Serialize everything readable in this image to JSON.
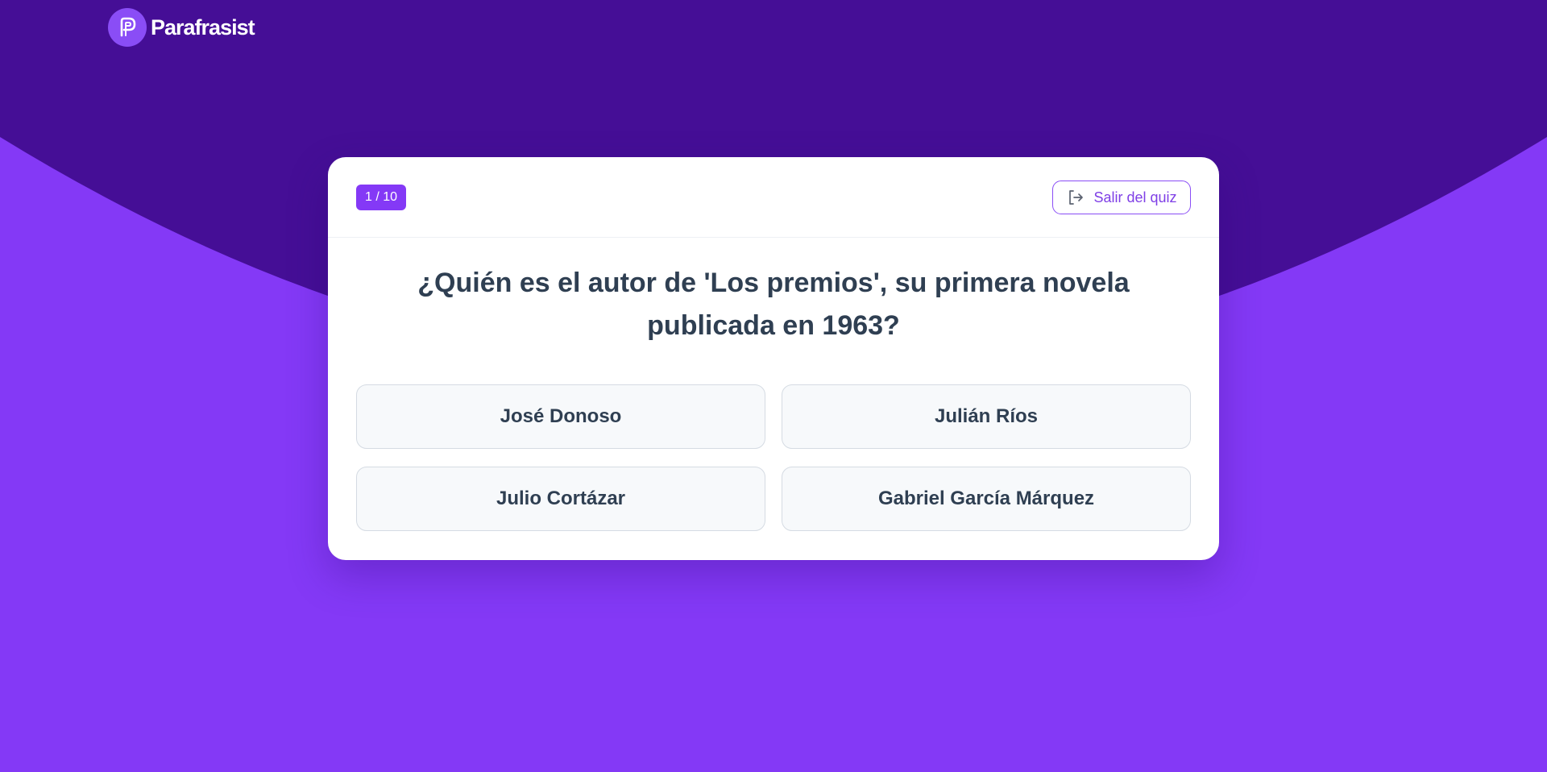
{
  "brand": {
    "name": "Parafrasist",
    "logo_icon": "parafrasist-p-logo"
  },
  "quiz": {
    "progress": "1 / 10",
    "exit_label": "Salir del quiz",
    "exit_icon": "exit-icon",
    "question": "¿Quién es el autor de 'Los premios', su primera novela publicada en 1963?",
    "answers": [
      "José Donoso",
      "Julián Ríos",
      "Julio Cortázar",
      "Gabriel García Márquez"
    ]
  },
  "colors": {
    "background": "#8439f6",
    "top_arc": "#450e96",
    "accent": "#8439f6",
    "text": "#2f3f52"
  }
}
